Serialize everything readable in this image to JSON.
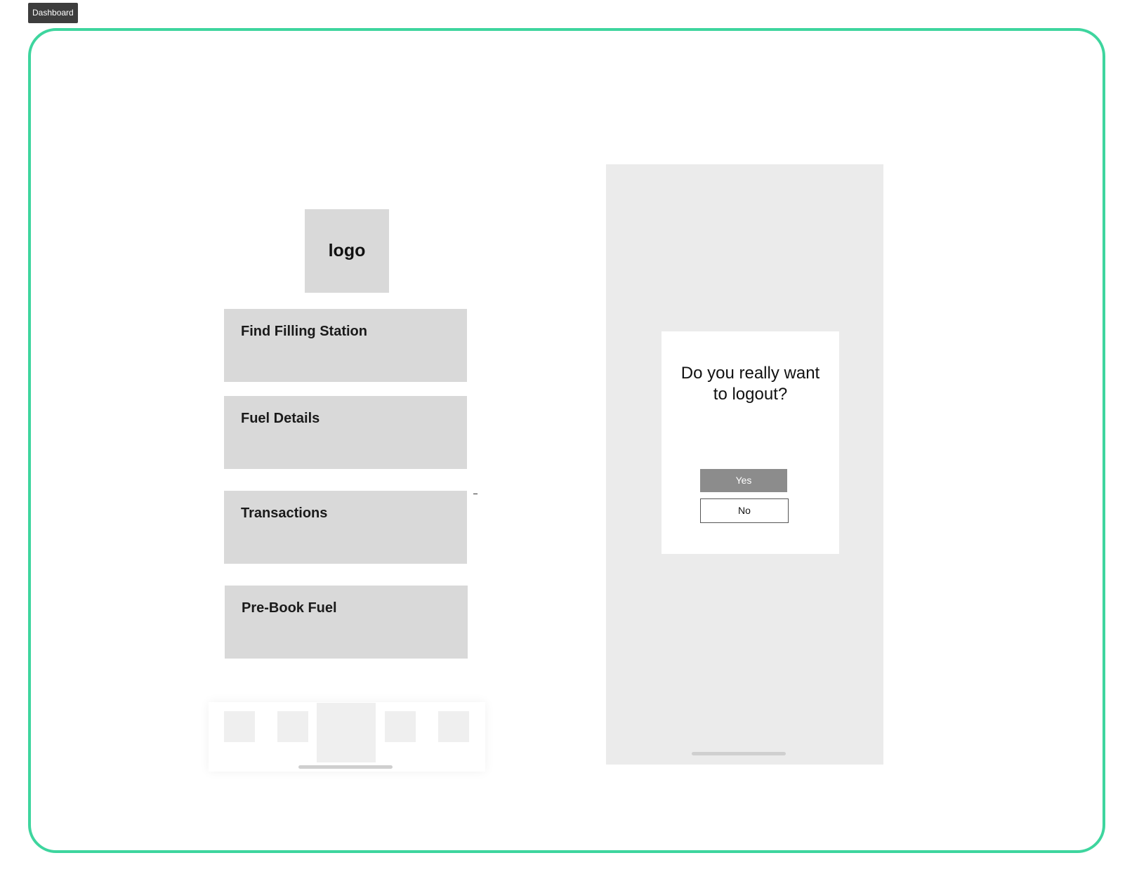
{
  "frame": {
    "label": "Dashboard",
    "border_color": "#3ed59e"
  },
  "dashboard": {
    "logo_text": "logo",
    "menu": [
      {
        "label": "Find Filling Station"
      },
      {
        "label": "Fuel Details"
      },
      {
        "label": "Transactions"
      },
      {
        "label": "Pre-Book Fuel"
      }
    ],
    "bottom_nav": {
      "items": [
        "nav-icon-1",
        "nav-icon-2",
        "nav-center-button",
        "nav-icon-4",
        "nav-icon-5"
      ]
    }
  },
  "logout_dialog": {
    "message": "Do you really want to logout?",
    "yes_label": "Yes",
    "no_label": "No"
  }
}
